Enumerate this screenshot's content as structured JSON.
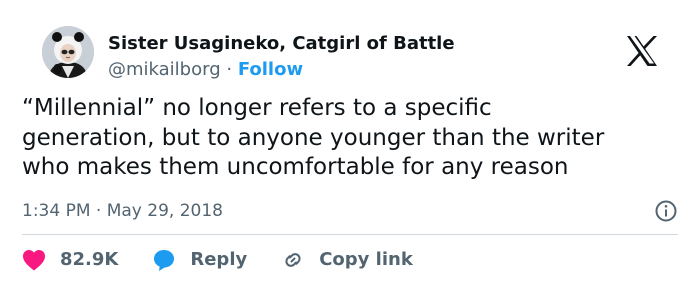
{
  "author": {
    "display_name": "Sister Usagineko, Catgirl of Battle",
    "handle": "@mikailborg",
    "separator": "·",
    "follow_label": "Follow",
    "avatar_icon": "panda-hood-avatar"
  },
  "brand": {
    "logo_icon": "x-logo"
  },
  "tweet": {
    "text": "“Millennial” no longer refers to a specific\ngeneration, but to anyone younger than the writer\nwho makes them uncomfortable for any reason",
    "timestamp": "1:34 PM · May 29, 2018"
  },
  "actions": {
    "like_count": "82.9K",
    "reply_label": "Reply",
    "copy_link_label": "Copy link"
  },
  "colors": {
    "text": "#0f1419",
    "secondary": "#536471",
    "link": "#1d9bf0",
    "like": "#f91880",
    "divider": "#cfd9de"
  }
}
